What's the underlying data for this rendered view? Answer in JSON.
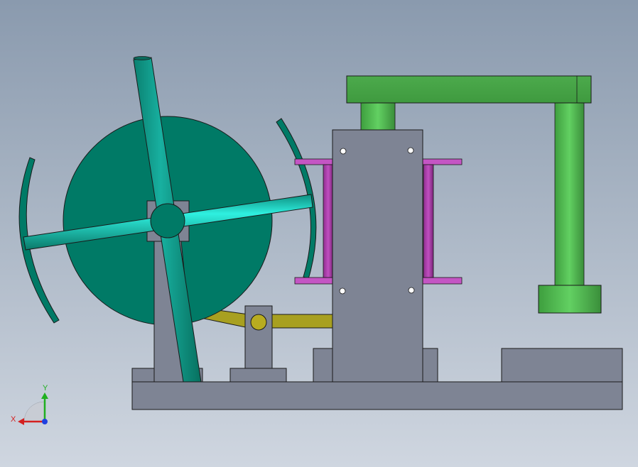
{
  "viewport": {
    "background_top": "#8a9aae",
    "background_bottom": "#cfd6e0"
  },
  "colors": {
    "base": "#7e8494",
    "wheel": "#007a66",
    "shaft": "#12c0b0",
    "shaft_dark": "#008a78",
    "guide": "#c455c4",
    "guide_dark": "#8e2e8e",
    "lever": "#46a646",
    "column": "#56c456",
    "rod": "#a8a020",
    "outline": "#1a1a1a"
  },
  "axis_triad": {
    "x_label": "X",
    "y_label": "Y",
    "x_color": "#d42020",
    "y_color": "#20b020",
    "z_color": "#2040e0"
  }
}
